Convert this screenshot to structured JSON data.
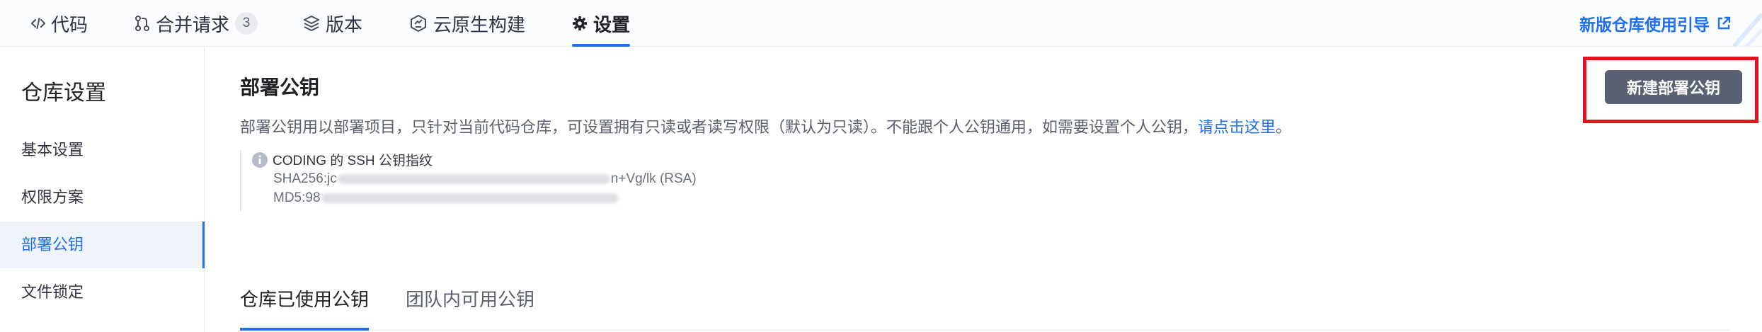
{
  "topnav": {
    "tabs": [
      {
        "label": "代码",
        "icon": "code-icon"
      },
      {
        "label": "合并请求",
        "icon": "merge-request-icon",
        "badge": "3"
      },
      {
        "label": "版本",
        "icon": "layers-icon"
      },
      {
        "label": "云原生构建",
        "icon": "cloud-build-icon"
      },
      {
        "label": "设置",
        "icon": "gear-icon",
        "active": true
      }
    ],
    "guide_link": "新版仓库使用引导",
    "guide_icon": "external-link-icon"
  },
  "sidebar": {
    "title": "仓库设置",
    "items": [
      {
        "label": "基本设置"
      },
      {
        "label": "权限方案"
      },
      {
        "label": "部署公钥",
        "active": true
      },
      {
        "label": "文件锁定"
      }
    ]
  },
  "main": {
    "title": "部署公钥",
    "description": "部署公钥用以部署项目，只针对当前代码仓库，可设置拥有只读或者读写权限（默认为只读）。不能跟个人公钥通用，如需要设置个人公钥，",
    "description_link": "请点击这里",
    "description_end": "。",
    "new_button": "新建部署公钥",
    "fingerprint": {
      "heading": "CODING 的 SSH 公钥指纹",
      "sha_prefix": "SHA256:jc",
      "sha_suffix": "n+Vg/lk (RSA)",
      "md5_prefix": "MD5:98"
    },
    "tabs": [
      {
        "label": "仓库已使用公钥",
        "active": true
      },
      {
        "label": "团队内可用公钥"
      }
    ]
  },
  "colors": {
    "accent": "#1f6ff0",
    "button": "#5a6172",
    "highlight_box": "#e0141e"
  }
}
